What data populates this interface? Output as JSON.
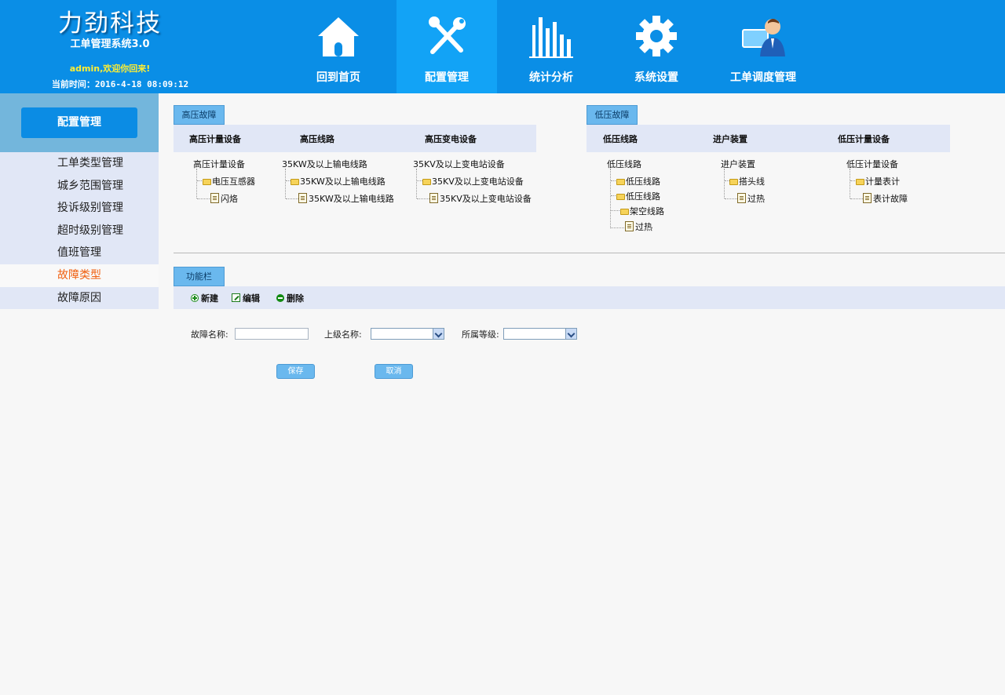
{
  "brand": {
    "company": "力劲科技",
    "system": "工单管理系统3.0",
    "welcome": "admin,欢迎你回来!",
    "time_label": "当前时间：",
    "time_value": "2016-4-18  08:09:12"
  },
  "nav": [
    {
      "label": "回到首页",
      "icon": "home-icon"
    },
    {
      "label": "配置管理",
      "icon": "tools-icon",
      "active": true
    },
    {
      "label": "统计分析",
      "icon": "bar-chart-icon"
    },
    {
      "label": "系统设置",
      "icon": "gear-icon"
    },
    {
      "label": "工单调度管理",
      "icon": "user-computer-icon"
    }
  ],
  "sidebar": {
    "title": "配置管理",
    "items": [
      {
        "label": "工单类型管理"
      },
      {
        "label": "城乡范围管理"
      },
      {
        "label": "投诉级别管理"
      },
      {
        "label": "超时级别管理"
      },
      {
        "label": "值班管理"
      },
      {
        "label": "故障类型",
        "active": true
      },
      {
        "label": "故障原因"
      }
    ]
  },
  "high_panel": {
    "tab": "高压故障",
    "columns": [
      {
        "head": "高压计量设备",
        "root": "高压计量设备",
        "children": [
          "电压互感器"
        ],
        "leaf": "闪烙"
      },
      {
        "head": "高压线路",
        "root": "35KW及以上输电线路",
        "children": [
          "35KW及以上输电线路"
        ],
        "leaf": "35KW及以上输电线路"
      },
      {
        "head": "高压变电设备",
        "root": "35KV及以上变电站设备",
        "children": [
          "35KV及以上变电站设备"
        ],
        "leaf": "35KV及以上变电站设备"
      }
    ]
  },
  "low_panel": {
    "tab": "低压故障",
    "columns": [
      {
        "head": "低压线路",
        "root": "低压线路",
        "children": [
          "低压线路",
          "低压线路",
          "架空线路"
        ],
        "leaf": "过热"
      },
      {
        "head": "进户装置",
        "root": "进户装置",
        "children": [
          "搭头线"
        ],
        "leaf": "过热"
      },
      {
        "head": "低压计量设备",
        "root": "低压计量设备",
        "children": [
          "计量表计"
        ],
        "leaf": "表计故障"
      }
    ]
  },
  "function_bar": {
    "tab": "功能栏",
    "new_label": "新建",
    "edit_label": "编辑",
    "delete_label": "删除"
  },
  "form": {
    "name_label": "故障名称:",
    "name_value": "",
    "parent_label": "上级名称:",
    "parent_value": "",
    "level_label": "所属等级:",
    "level_value": "",
    "save_label": "保存",
    "cancel_label": "取消"
  },
  "colors": {
    "header_bg": "#0a8ee6",
    "nav_active_bg": "#12a3f6",
    "sidebar_active_text": "#f06010",
    "tab_bg": "#6ab8ee",
    "panel_head_bg": "#e1e7f6"
  }
}
